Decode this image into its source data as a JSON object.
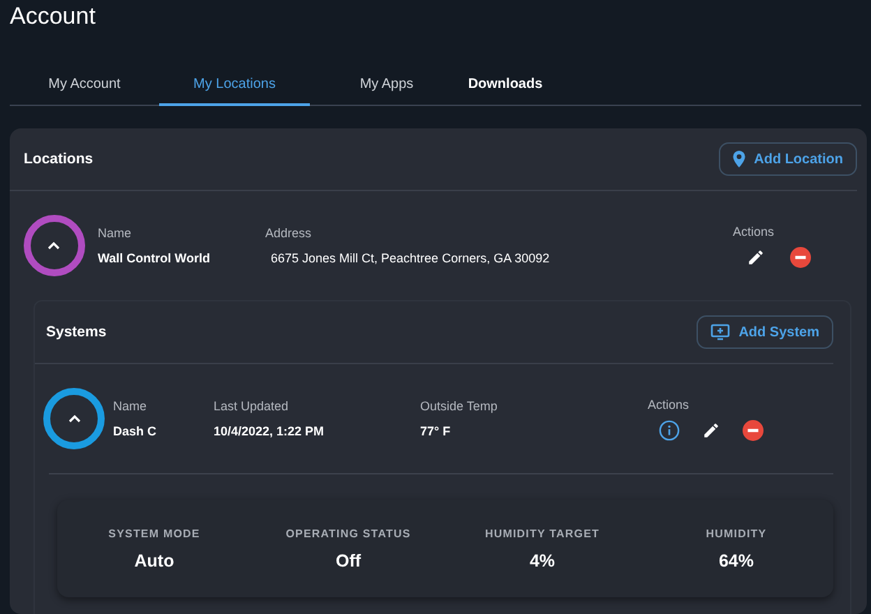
{
  "page_title": "Account",
  "tabs": [
    {
      "label": "My Account",
      "selected": false,
      "bold": false
    },
    {
      "label": "My Locations",
      "selected": true,
      "bold": false
    },
    {
      "label": "My Apps",
      "selected": false,
      "bold": false
    },
    {
      "label": "Downloads",
      "selected": false,
      "bold": true
    }
  ],
  "locations": {
    "title": "Locations",
    "add_button": "Add Location",
    "location": {
      "expand_button": {
        "expanded": true,
        "color": "#b04cc0"
      },
      "fields": [
        {
          "label": "Name",
          "value": "Wall Control World"
        },
        {
          "label": "Address",
          "value": "6675 Jones Mill Ct, Peachtree Corners, GA 30092"
        }
      ],
      "actions_label": "Actions",
      "systems": {
        "title": "Systems",
        "add_button": "Add System",
        "system": {
          "expand_button": {
            "expanded": true,
            "color": "#1a9be0"
          },
          "fields": [
            {
              "label": "Name",
              "value": "Dash C"
            },
            {
              "label": "Last Updated",
              "value": "10/4/2022, 1:22 PM"
            },
            {
              "label": "Outside Temp",
              "value": "77° F"
            }
          ],
          "actions_label": "Actions",
          "stats": [
            {
              "label": "SYSTEM MODE",
              "value": "Auto"
            },
            {
              "label": "OPERATING STATUS",
              "value": "Off"
            },
            {
              "label": "HUMIDITY TARGET",
              "value": "4%"
            },
            {
              "label": "HUMIDITY",
              "value": "64%"
            }
          ]
        }
      }
    }
  }
}
